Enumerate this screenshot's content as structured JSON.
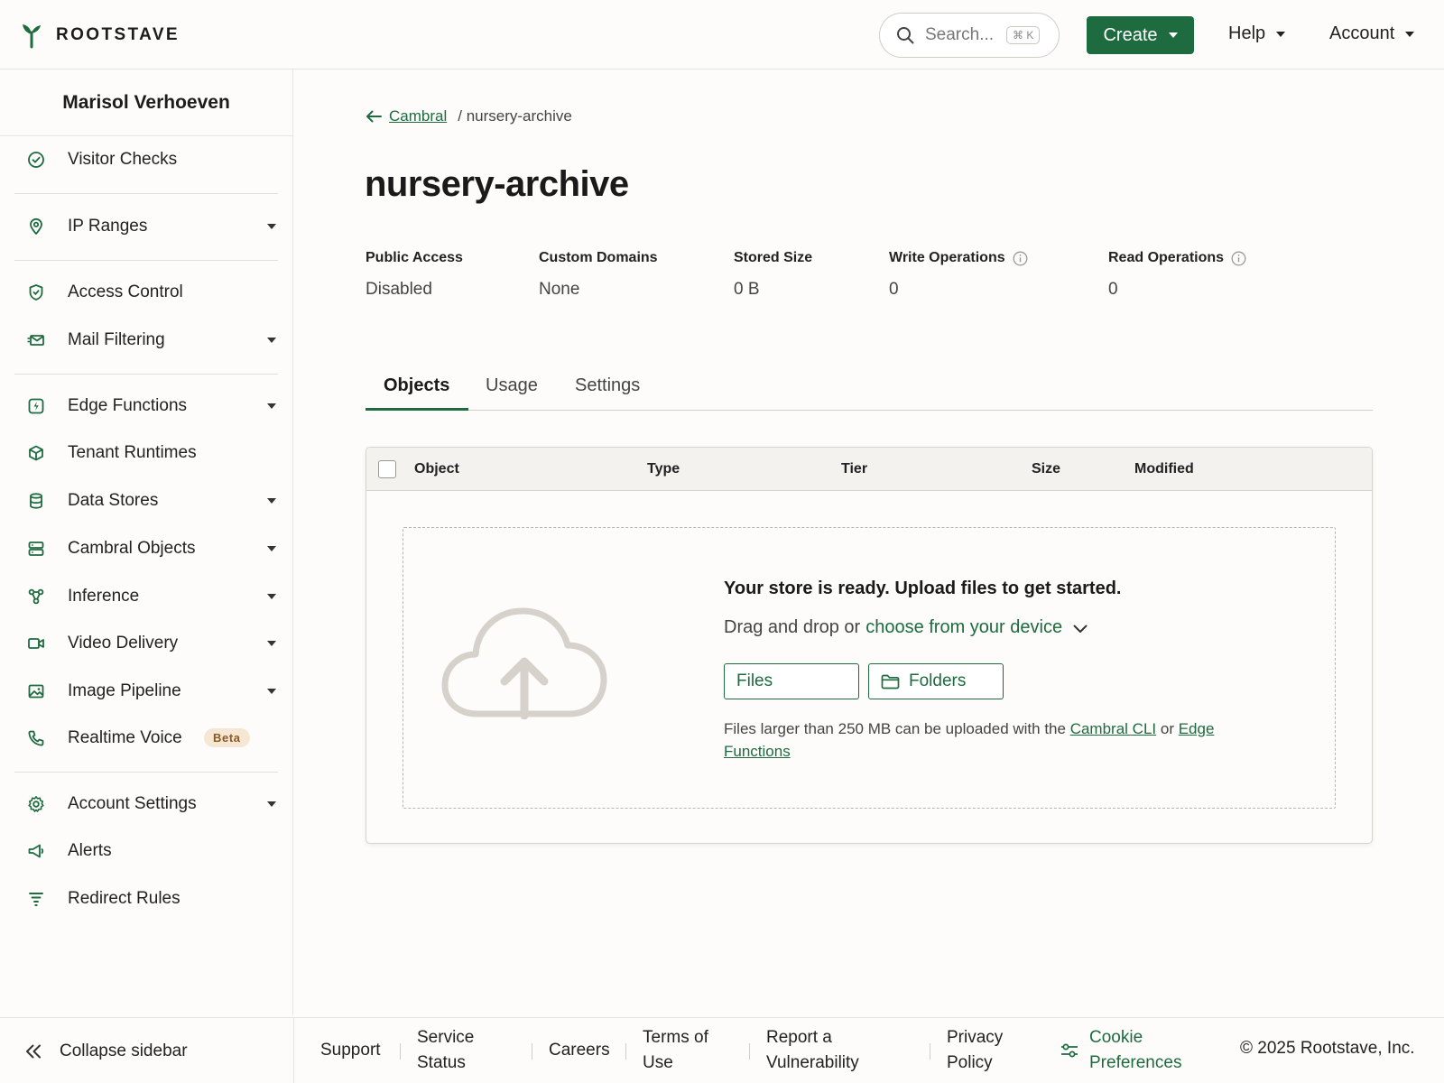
{
  "brand": {
    "name": "ROOTSTAVE",
    "accent": "#1d6b3f"
  },
  "header": {
    "search_placeholder": "Search...",
    "search_shortcut": "⌘ K",
    "create_label": "Create",
    "help_label": "Help",
    "account_label": "Account"
  },
  "sidebar": {
    "user_name": "Marisol Verhoeven",
    "items": [
      {
        "label": "Visitor Checks",
        "icon": "check-circle-icon",
        "has_submenu": false
      },
      {
        "label": "IP Ranges",
        "icon": "map-pin-icon",
        "has_submenu": true
      },
      {
        "label": "Access Control",
        "icon": "shield-icon",
        "has_submenu": false
      },
      {
        "label": "Mail Filtering",
        "icon": "mail-icon",
        "has_submenu": true
      },
      {
        "label": "Edge Functions",
        "icon": "lightning-icon",
        "has_submenu": true
      },
      {
        "label": "Tenant Runtimes",
        "icon": "cube-icon",
        "has_submenu": false
      },
      {
        "label": "Data Stores",
        "icon": "database-icon",
        "has_submenu": true
      },
      {
        "label": "Cambral Objects",
        "icon": "storage-icon",
        "has_submenu": true
      },
      {
        "label": "Inference",
        "icon": "network-icon",
        "has_submenu": true
      },
      {
        "label": "Video Delivery",
        "icon": "video-icon",
        "has_submenu": true
      },
      {
        "label": "Image Pipeline",
        "icon": "image-icon",
        "has_submenu": true
      },
      {
        "label": "Realtime Voice",
        "icon": "phone-icon",
        "has_submenu": false,
        "badge": "Beta"
      },
      {
        "label": "Account Settings",
        "icon": "gear-icon",
        "has_submenu": true
      },
      {
        "label": "Alerts",
        "icon": "megaphone-icon",
        "has_submenu": false
      },
      {
        "label": "Redirect Rules",
        "icon": "filter-icon",
        "has_submenu": false
      }
    ]
  },
  "breadcrumb": {
    "parent": "Cambral",
    "current": "/ nursery-archive"
  },
  "page_title": "nursery-archive",
  "stats": [
    {
      "label": "Public Access",
      "value": "Disabled",
      "info": false
    },
    {
      "label": "Custom Domains",
      "value": "None",
      "info": false
    },
    {
      "label": "Stored Size",
      "value": "0 B",
      "info": false
    },
    {
      "label": "Write Operations",
      "value": "0",
      "info": true
    },
    {
      "label": "Read Operations",
      "value": "0",
      "info": true
    }
  ],
  "tabs": [
    {
      "label": "Objects",
      "active": true
    },
    {
      "label": "Usage",
      "active": false
    },
    {
      "label": "Settings",
      "active": false
    }
  ],
  "table": {
    "columns": [
      "Object",
      "Type",
      "Tier",
      "Size",
      "Modified"
    ]
  },
  "dropzone": {
    "heading": "Your store is ready. Upload files to get started.",
    "sub_prefix": "Drag and drop or",
    "sub_link": "choose from your device",
    "files_button": "Files",
    "folders_button": "Folders",
    "note_prefix": "Files larger than 250 MB can be uploaded with the",
    "note_link1": "Cambral CLI",
    "note_or": "or",
    "note_link2": "Edge Functions"
  },
  "footer": {
    "collapse_label": "Collapse sidebar",
    "support": "Support",
    "service_status": [
      "Service",
      "Status"
    ],
    "careers": "Careers",
    "terms": [
      "Terms of",
      "Use"
    ],
    "report": [
      "Report a",
      "Vulnerability"
    ],
    "privacy": [
      "Privacy",
      "Policy"
    ],
    "cookie": [
      "Cookie",
      "Preferences"
    ],
    "copyright": "© 2025 Rootstave, Inc."
  }
}
